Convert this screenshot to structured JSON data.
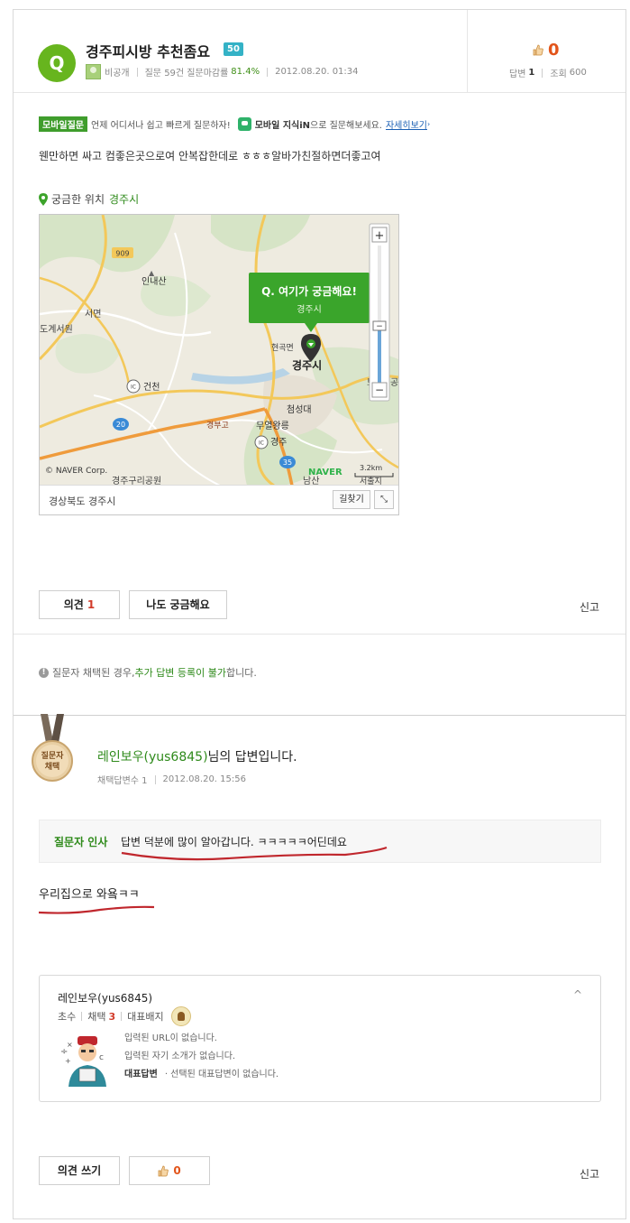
{
  "question": {
    "badge": "Q",
    "title": "경주피시방 추천좀요",
    "level": "50",
    "author": "비공개",
    "stats_prefix": "질문 59건 질문마감률",
    "close_rate": "81.4%",
    "date": "2012.08.20. 01:34",
    "likes": "0",
    "answers_label": "답변",
    "answers_count": "1",
    "views_label": "조회",
    "views_count": "600",
    "body": "웬만하면 싸고 컴좋은곳으로여 안복잡한데로 ㅎㅎㅎ알바가친절하면더좋고여"
  },
  "mobile_bar": {
    "tag": "모바일질문",
    "text1": "언제 어디서나 쉽고 빠르게 질문하자!",
    "strong": "모바일 지식iN",
    "text2": "으로 질문해보세요.",
    "more": "자세히보기"
  },
  "location": {
    "label": "궁금한 위치",
    "city": "경주시"
  },
  "map": {
    "labels": {
      "road_909": "909",
      "mountain": "인내산",
      "seomyeon": "서면",
      "west_place": "도계서원",
      "geoncheon": "건천",
      "road_20": "20",
      "hyeongok": "현곡면",
      "gyeongju": "경주시",
      "cheomseong": "첨성대",
      "muyeol": "무열왕릉",
      "ic_gyeongju": "경주",
      "gyeongbu": "경부고",
      "road_35": "35",
      "bottom_park": "경주구리공원",
      "south": "남산",
      "east_edge": "보",
      "east_edge2": "공",
      "se_place": "서출지",
      "ic": "IC"
    },
    "popup_title": "Q. 여기가 궁금해요!",
    "popup_sub": "경주시",
    "copyright": "© NAVER Corp.",
    "naver": "NAVER",
    "scale": "3.2km",
    "address": "경상북도 경주시",
    "road_btn": "길찾기",
    "zoom_in": "+",
    "zoom_out": "−"
  },
  "actions": {
    "opinion_label": "의견",
    "opinion_count": "1",
    "curious_label": "나도 궁금해요",
    "report": "신고"
  },
  "notice": {
    "pre": "질문자 채택된 경우, ",
    "highlight": "추가 답변 등록이 불가",
    "post": "합니다."
  },
  "answer": {
    "medal_line1": "질문자",
    "medal_line2": "채택",
    "author": "레인보우(yus6845)",
    "title_suffix": "님의 답변입니다.",
    "adopt_label": "채택답변수 1",
    "date": "2012.08.20. 15:56",
    "greet_label": "질문자 인사",
    "greet_text": "답변 덕분에 많이 알아갑니다. ㅋㅋㅋㅋㅋ어딘데요",
    "body": "우리집으로 와욬ㅋㅋ"
  },
  "profile": {
    "name": "레인보우(yus6845)",
    "rank": "초수",
    "adopt_label": "채택",
    "adopt_count": "3",
    "badge_label": "대표배지",
    "url_line": "입력된 URL이 없습니다.",
    "intro_line": "입력된 자기 소개가 없습니다.",
    "rep_label": "대표답변",
    "rep_text": "· 선택된 대표답변이 없습니다.",
    "collapse": "^"
  },
  "footer": {
    "write_label": "의견 쓰기",
    "likes": "0",
    "report": "신고"
  },
  "colors": {
    "accent_green": "#67b51e",
    "text_green": "#2e8a1a",
    "like_orange": "#e2541a",
    "mark_red": "#c0272d"
  }
}
